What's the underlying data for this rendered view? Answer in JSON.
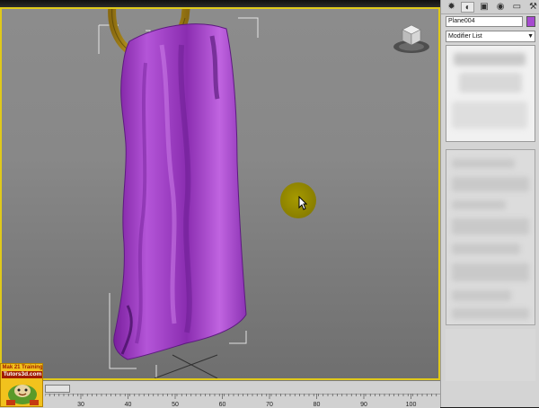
{
  "command_panel": {
    "object_name": "Plane004",
    "object_color": "#a64bd0",
    "modifier_list_label": "Modifier List",
    "tabs": [
      "create-icon",
      "modify-icon",
      "hierarchy-icon",
      "motion-icon",
      "display-icon",
      "utilities-icon"
    ]
  },
  "viewport": {
    "active_border_color": "#e0c91a",
    "cloth_color": "#a64bd0",
    "ring_color": "#c9a21c"
  },
  "timeline": {
    "tick_labels": [
      "30",
      "40",
      "50",
      "60",
      "70",
      "80",
      "90",
      "100"
    ]
  },
  "watermark": {
    "line1": "Mak 21 Training",
    "line2": "Tutors3d.com"
  }
}
